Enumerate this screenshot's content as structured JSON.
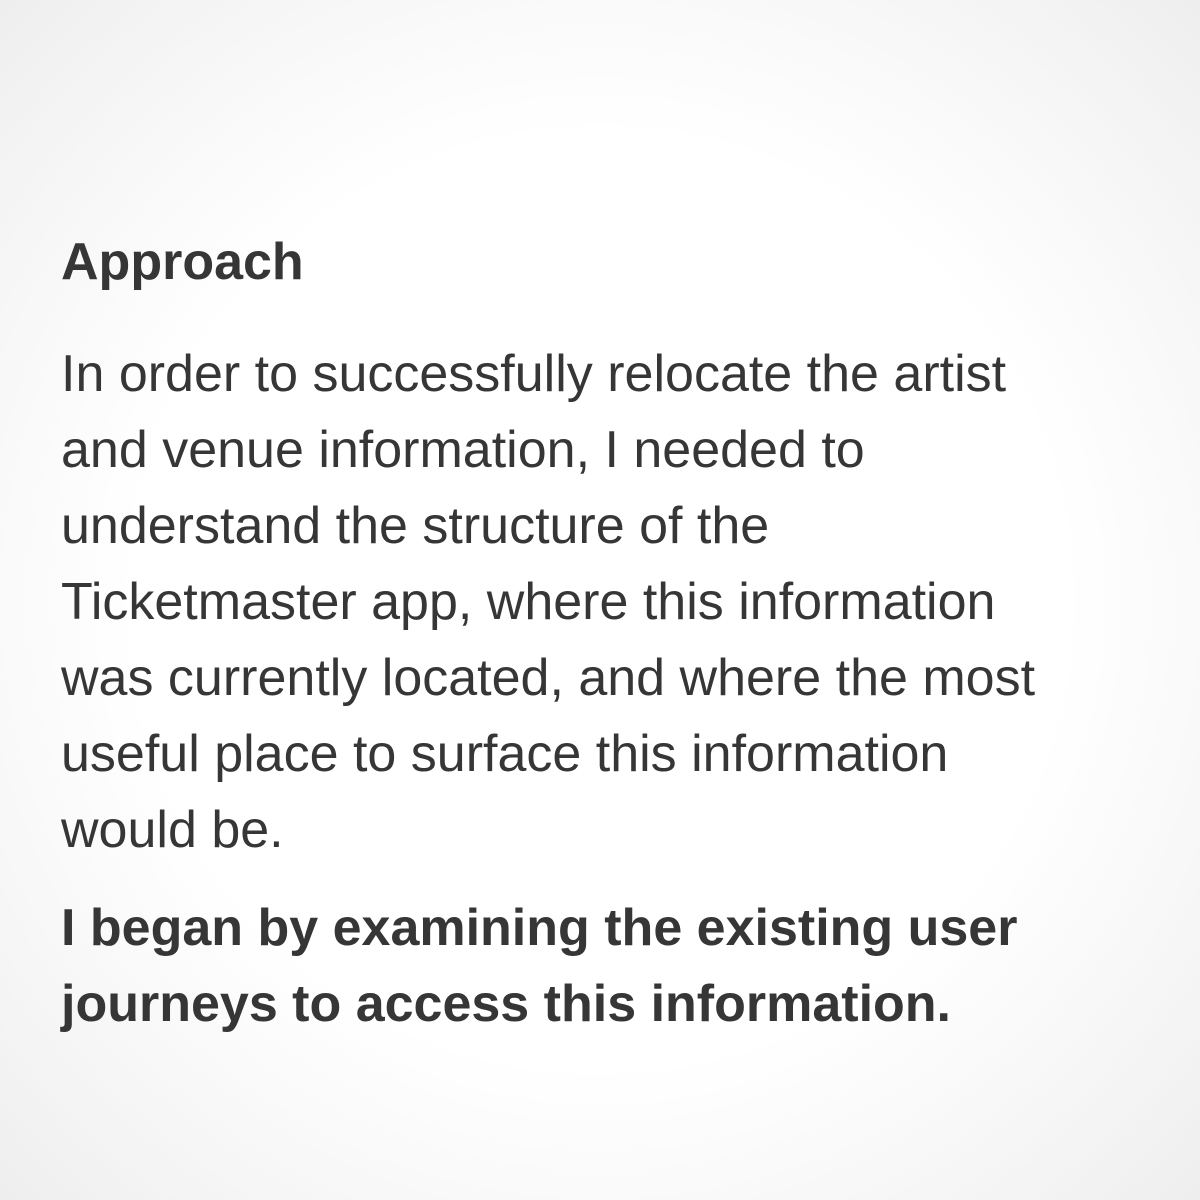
{
  "document": {
    "heading": "Approach",
    "paragraph": "In order to successfully relocate the artist\nand venue information, I needed to\nunderstand the structure of the\nTicketmaster app, where this information\nwas currently located, and where the most\nuseful place to surface this information\nwould be.",
    "emphasis": "I began by examining the existing user\njourneys to access this information."
  },
  "colors": {
    "text": "#363636",
    "background": "#ffffff"
  }
}
